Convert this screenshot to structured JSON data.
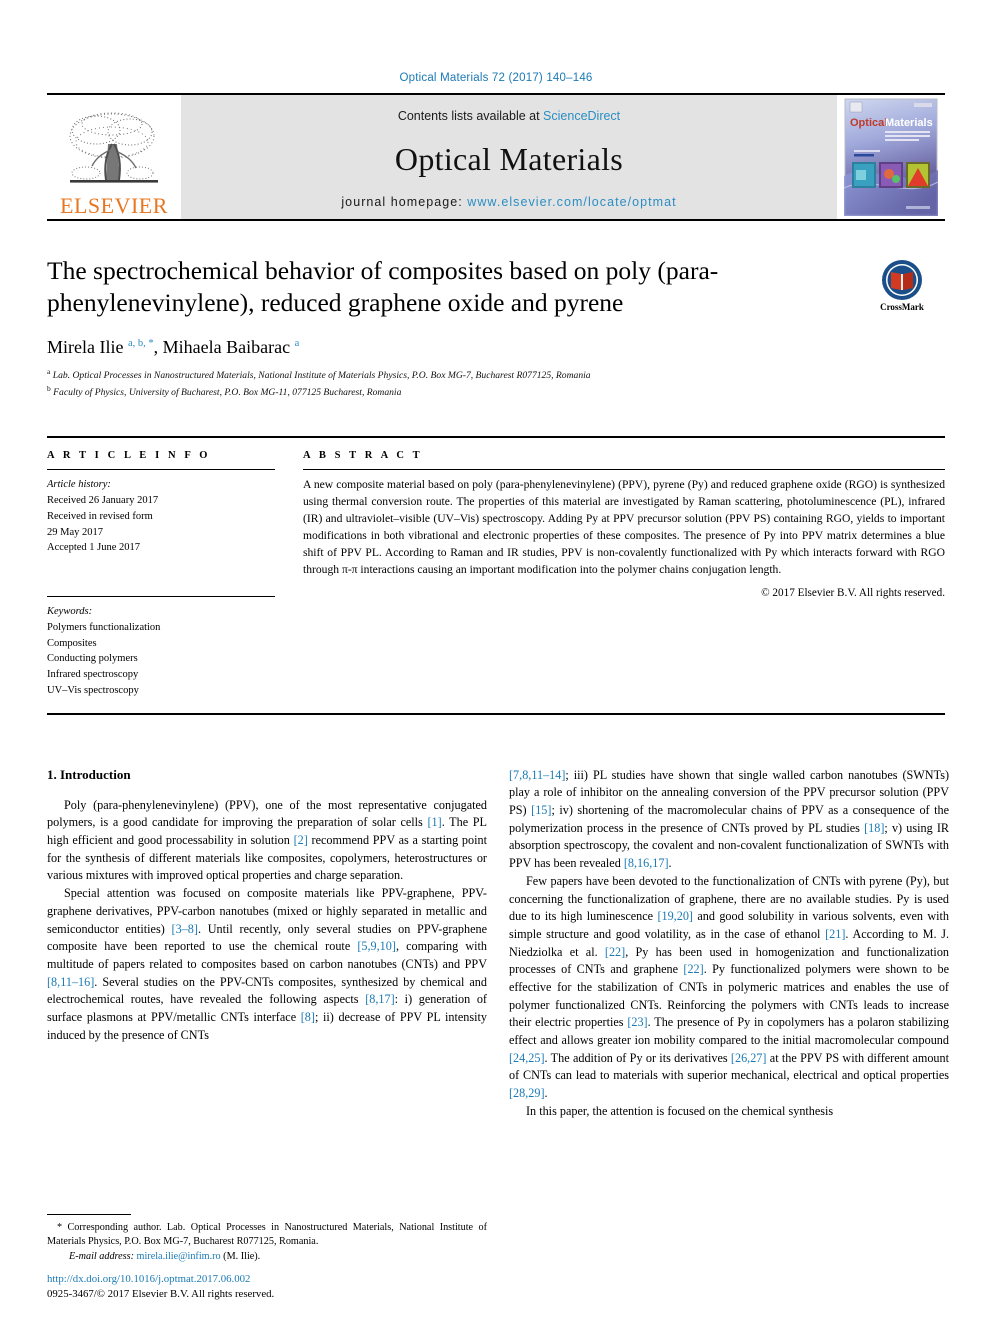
{
  "running_head": "Optical Materials 72 (2017) 140–146",
  "masthead": {
    "contents_prefix": "Contents lists available at ",
    "sciencedirect": "ScienceDirect",
    "journal_name": "Optical Materials",
    "homepage_prefix": "journal homepage: ",
    "homepage_url": "www.elsevier.com/locate/optmat",
    "publisher_wordmark": "ELSEVIER",
    "cover_title_1": "Optical",
    "cover_title_2": "Materials",
    "logo_icon": "elsevier-tree-icon",
    "accent_link_color": "#2b8ec4",
    "publisher_color": "#e87722",
    "masthead_bg": "#e3e3e3"
  },
  "article": {
    "title": "The spectrochemical behavior of composites based on poly (para-phenylenevinylene), reduced graphene oxide and pyrene",
    "authors_html": "Mirela Ilie <sup>a, b, *</sup>, Mihaela Baibarac <sup>a</sup>",
    "affiliation_a": "Lab. Optical Processes in Nanostructured Materials, National Institute of Materials Physics, P.O. Box MG-7, Bucharest R077125, Romania",
    "affiliation_b": "Faculty of Physics, University of Bucharest, P.O. Box MG-11, 077125 Bucharest, Romania",
    "crossmark_label": "CrossMark"
  },
  "article_info": {
    "heading": "A R T I C L E  I N F O",
    "history_label": "Article history:",
    "history_lines": [
      "Received 26 January 2017",
      "Received in revised form",
      "29 May 2017",
      "Accepted 1 June 2017"
    ],
    "keywords_label": "Keywords:",
    "keywords": [
      "Polymers functionalization",
      "Composites",
      "Conducting polymers",
      "Infrared spectroscopy",
      "UV–Vis spectroscopy"
    ]
  },
  "abstract": {
    "heading": "A B S T R A C T",
    "text": "A new composite material based on poly (para-phenylenevinylene) (PPV), pyrene (Py) and reduced graphene oxide (RGO) is synthesized using thermal conversion route. The properties of this material are investigated by Raman scattering, photoluminescence (PL), infrared (IR) and ultraviolet–visible (UV–Vis) spectroscopy. Adding Py at PPV precursor solution (PPV PS) containing RGO, yields to important modifications in both vibrational and electronic properties of these composites. The presence of Py into PPV matrix determines a blue shift of PPV PL. According to Raman and IR studies, PPV is non-covalently functionalized with Py which interacts forward with RGO through π-π interactions causing an important modification into the polymer chains conjugation length.",
    "copyright": "© 2017 Elsevier B.V. All rights reserved."
  },
  "body": {
    "section_title": "1. Introduction",
    "left_paragraphs_html": [
      "Poly (para-phenylenevinylene) (PPV), one of the most representative conjugated polymers, is a good candidate for improving the preparation of solar cells <span class=\"ref\">[1]</span>. The PL high efficient and good processability in solution <span class=\"ref\">[2]</span> recommend PPV as a starting point for the synthesis of different materials like composites, copolymers, heterostructures or various mixtures with improved optical properties and charge separation.",
      "Special attention was focused on composite materials like PPV-graphene, PPV-graphene derivatives, PPV-carbon nanotubes (mixed or highly separated in metallic and semiconductor entities) <span class=\"ref\">[3–8]</span>. Until recently, only several studies on PPV-graphene composite have been reported to use the chemical route <span class=\"ref\">[5,9,10]</span>, comparing with multitude of papers related to composites based on carbon nanotubes (CNTs) and PPV <span class=\"ref\">[8,11–16]</span>. Several studies on the PPV-CNTs composites, synthesized by chemical and electrochemical routes, have revealed the following aspects <span class=\"ref\">[8,17]</span>: i) generation of surface plasmons at PPV/metallic CNTs interface <span class=\"ref\">[8]</span>; ii) decrease of PPV PL intensity induced by the presence of CNTs"
    ],
    "right_paragraphs_html": [
      "<span class=\"ref\">[7,8,11–14]</span>; iii) PL studies have shown that single walled carbon nanotubes (SWNTs) play a role of inhibitor on the annealing conversion of the PPV precursor solution (PPV PS) <span class=\"ref\">[15]</span>; iv) shortening of the macromolecular chains of PPV as a consequence of the polymerization process in the presence of CNTs proved by PL studies <span class=\"ref\">[18]</span>; v) using IR absorption spectroscopy, the covalent and non-covalent functionalization of SWNTs with PPV has been revealed <span class=\"ref\">[8,16,17]</span>.",
      "Few papers have been devoted to the functionalization of CNTs with pyrene (Py), but concerning the functionalization of graphene, there are no available studies. Py is used due to its high luminescence <span class=\"ref\">[19,20]</span> and good solubility in various solvents, even with simple structure and good volatility, as in the case of ethanol <span class=\"ref\">[21]</span>. According to M. J. Niedziolka et al. <span class=\"ref\">[22]</span>, Py has been used in homogenization and functionalization processes of CNTs and graphene <span class=\"ref\">[22]</span>. Py functionalized polymers were shown to be effective for the stabilization of CNTs in polymeric matrices and enables the use of polymer functionalized CNTs. Reinforcing the polymers with CNTs leads to increase their electric properties <span class=\"ref\">[23]</span>. The presence of Py in copolymers has a polaron stabilizing effect and allows greater ion mobility compared to the initial macromolecular compound <span class=\"ref\">[24,25]</span>. The addition of Py or its derivatives <span class=\"ref\">[26,27]</span> at the PPV PS with different amount of CNTs can lead to materials with superior mechanical, electrical and optical properties <span class=\"ref\">[28,29]</span>.",
      "In this paper, the attention is focused on the chemical synthesis"
    ]
  },
  "footnote": {
    "corresponding": "* Corresponding author. Lab. Optical Processes in Nanostructured Materials, National Institute of Materials Physics, P.O. Box MG-7, Bucharest R077125, Romania.",
    "email_label": "E-mail address:",
    "email": "mirela.ilie@infim.ro",
    "email_suffix": "(M. Ilie).",
    "doi": "http://dx.doi.org/10.1016/j.optmat.2017.06.002",
    "issn_line": "0925-3467/© 2017 Elsevier B.V. All rights reserved."
  }
}
